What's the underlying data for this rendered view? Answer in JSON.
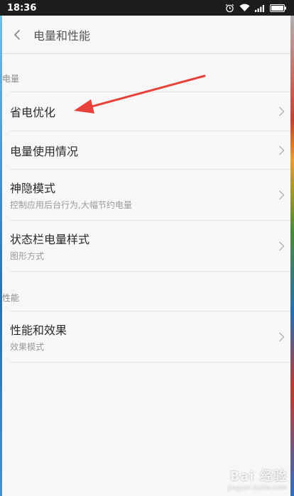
{
  "status_bar": {
    "time": "18:36",
    "icons": [
      "alarm-icon",
      "wifi-icon",
      "signal-icon",
      "battery-icon"
    ]
  },
  "header": {
    "back_icon": "chevron-left-icon",
    "title": "电量和性能"
  },
  "sections": [
    {
      "label": "电量",
      "items": [
        {
          "title": "省电优化",
          "subtitle": ""
        },
        {
          "title": "电量使用情况",
          "subtitle": ""
        },
        {
          "title": "神隐模式",
          "subtitle": "控制应用后台行为,大幅节约电量"
        },
        {
          "title": "状态栏电量样式",
          "subtitle": "图形方式"
        }
      ]
    },
    {
      "label": "性能",
      "items": [
        {
          "title": "性能和效果",
          "subtitle": "效果模式"
        }
      ]
    }
  ],
  "annotation": {
    "color": "#e8413c",
    "target": "省电优化"
  },
  "watermark": {
    "main": "Bai 经验",
    "sub": "jingyan.baidu.com"
  },
  "colors": {
    "background": "#f7f7f7",
    "status_bar": "#1c1c1c",
    "title_text": "#2a2a2a",
    "sub_text": "#9a9a9a"
  }
}
